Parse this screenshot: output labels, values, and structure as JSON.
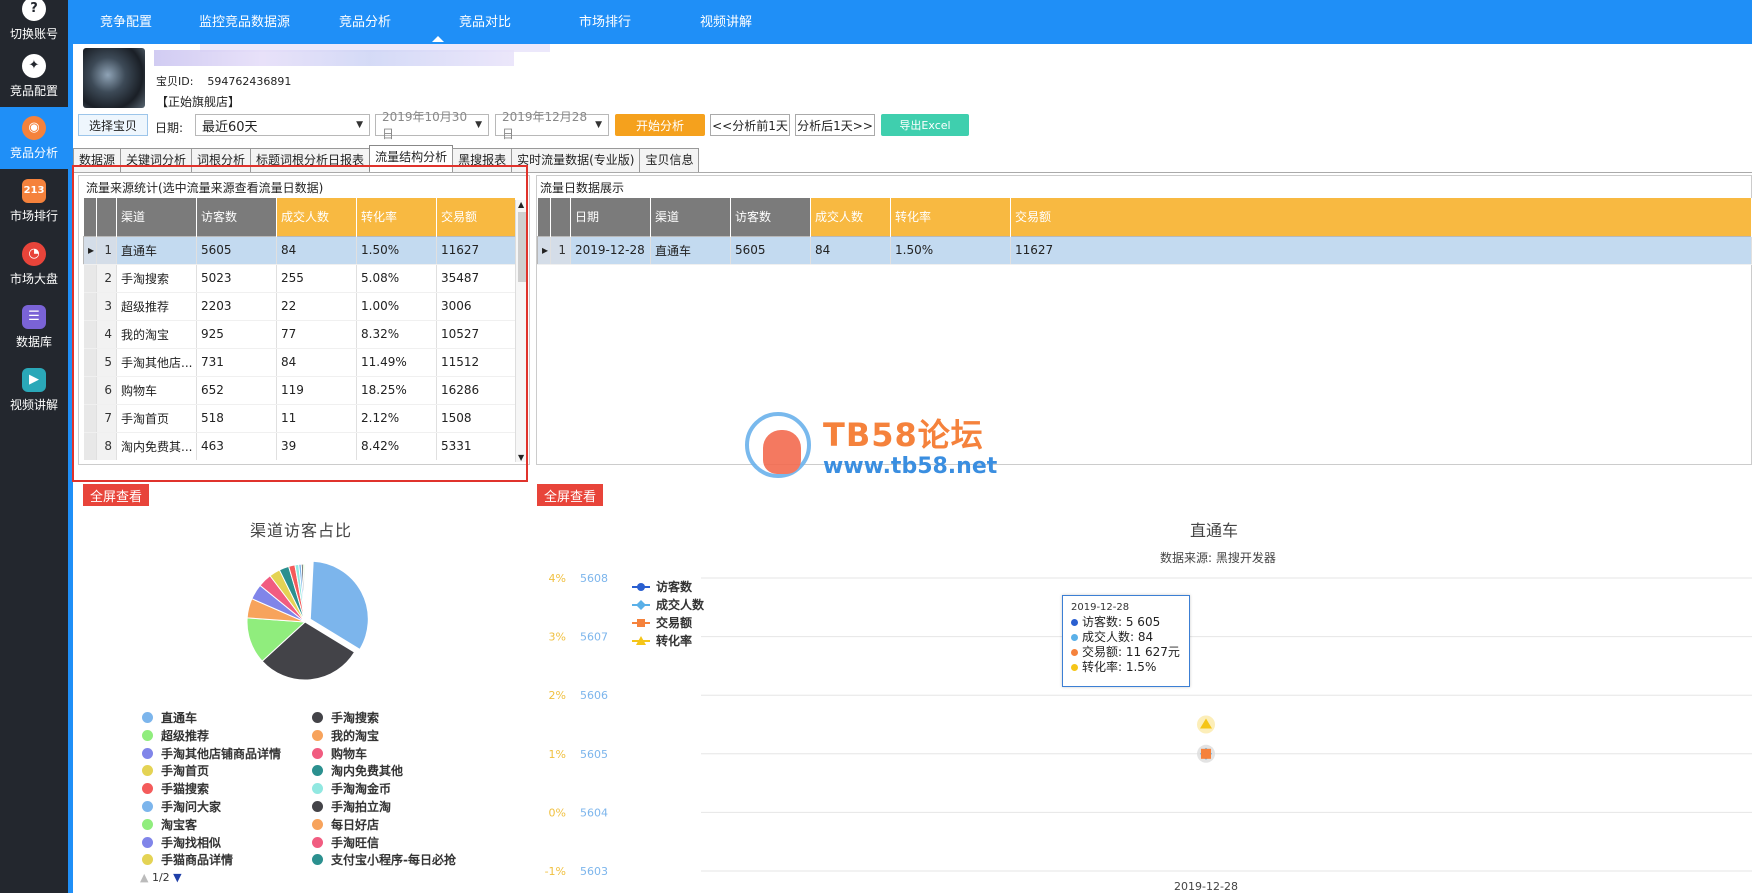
{
  "sidebar": {
    "items": [
      {
        "label": "切换账号",
        "icon": "switch-account-icon",
        "color": "#ffffff"
      },
      {
        "label": "竞品配置",
        "icon": "bird-icon",
        "color": "#ffffff"
      },
      {
        "label": "竞品分析",
        "icon": "eye-icon",
        "color": "#f5823c"
      },
      {
        "label": "市场排行",
        "icon": "ranking-icon",
        "color": "#f5823c"
      },
      {
        "label": "市场大盘",
        "icon": "dashboard-icon",
        "color": "#e8443a"
      },
      {
        "label": "数据库",
        "icon": "database-icon",
        "color": "#7a63d6"
      },
      {
        "label": "视频讲解",
        "icon": "video-icon",
        "color": "#2aa8b8"
      }
    ]
  },
  "topnav": {
    "items": [
      "竞争配置",
      "监控竞品数据源",
      "竞品分析",
      "竞品对比",
      "市场排行",
      "视频讲解"
    ]
  },
  "product": {
    "id_label": "宝贝ID:",
    "id_value": "594762436891",
    "shop": "【正始旗舰店】"
  },
  "toolbar": {
    "choose_label": "选择宝贝",
    "date_label": "日期:",
    "range_value": "最近60天",
    "start_date": "2019年10月30日",
    "end_date": "2019年12月28日",
    "start_label": "开始分析",
    "prev_label": "<<分析前1天",
    "next_label": "分析后1天>>",
    "excel_label": "导出Excel"
  },
  "tabs": [
    "数据源",
    "关键词分析",
    "词根分析",
    "标题词根分析日报表",
    "流量结构分析",
    "黑搜报表",
    "实时流量数据(专业版)",
    "宝贝信息"
  ],
  "left_panel": {
    "title": "流量来源统计(选中流量来源查看流量日数据)",
    "columns": [
      "渠道",
      "访客数",
      "成交人数",
      "转化率",
      "交易额"
    ],
    "rows": [
      {
        "n": "1",
        "channel": "直通车",
        "visitors": "5605",
        "buyers": "84",
        "rate": "1.50%",
        "amount": "11627"
      },
      {
        "n": "2",
        "channel": "手淘搜索",
        "visitors": "5023",
        "buyers": "255",
        "rate": "5.08%",
        "amount": "35487"
      },
      {
        "n": "3",
        "channel": "超级推荐",
        "visitors": "2203",
        "buyers": "22",
        "rate": "1.00%",
        "amount": "3006"
      },
      {
        "n": "4",
        "channel": "我的淘宝",
        "visitors": "925",
        "buyers": "77",
        "rate": "8.32%",
        "amount": "10527"
      },
      {
        "n": "5",
        "channel": "手淘其他店...",
        "visitors": "731",
        "buyers": "84",
        "rate": "11.49%",
        "amount": "11512"
      },
      {
        "n": "6",
        "channel": "购物车",
        "visitors": "652",
        "buyers": "119",
        "rate": "18.25%",
        "amount": "16286"
      },
      {
        "n": "7",
        "channel": "手淘首页",
        "visitors": "518",
        "buyers": "11",
        "rate": "2.12%",
        "amount": "1508"
      },
      {
        "n": "8",
        "channel": "淘内免费其...",
        "visitors": "463",
        "buyers": "39",
        "rate": "8.42%",
        "amount": "5331"
      }
    ]
  },
  "right_panel": {
    "title": "流量日数据展示",
    "columns": [
      "日期",
      "渠道",
      "访客数",
      "成交人数",
      "转化率",
      "交易额"
    ],
    "rows": [
      {
        "n": "1",
        "date": "2019-12-28",
        "channel": "直通车",
        "visitors": "5605",
        "buyers": "84",
        "rate": "1.50%",
        "amount": "11627"
      }
    ]
  },
  "fullscreen_label": "全屏查看",
  "pie": {
    "title": "渠道访客占比",
    "legend": [
      {
        "name": "直通车",
        "color": "#7cb5ec"
      },
      {
        "name": "手淘搜索",
        "color": "#434348"
      },
      {
        "name": "超级推荐",
        "color": "#90ed7d"
      },
      {
        "name": "我的淘宝",
        "color": "#f7a35c"
      },
      {
        "name": "手淘其他店铺商品详情",
        "color": "#8085e9"
      },
      {
        "name": "购物车",
        "color": "#f15c80"
      },
      {
        "name": "手淘首页",
        "color": "#e4d354"
      },
      {
        "name": "淘内免费其他",
        "color": "#2b908f"
      },
      {
        "name": "手猫搜索",
        "color": "#f45b5b"
      },
      {
        "name": "手淘淘金币",
        "color": "#91e8e1"
      },
      {
        "name": "手淘问大家",
        "color": "#7cb5ec"
      },
      {
        "name": "手淘拍立淘",
        "color": "#434348"
      },
      {
        "name": "淘宝客",
        "color": "#90ed7d"
      },
      {
        "name": "每日好店",
        "color": "#f7a35c"
      },
      {
        "name": "手淘找相似",
        "color": "#8085e9"
      },
      {
        "name": "手淘旺信",
        "color": "#f15c80"
      },
      {
        "name": "手猫商品详情",
        "color": "#e4d354"
      },
      {
        "name": "支付宝小程序-每日必抢",
        "color": "#2b908f"
      }
    ],
    "pager": "1/2"
  },
  "chart_data": [
    {
      "type": "pie",
      "title": "渠道访客占比",
      "categories": [
        "直通车",
        "手淘搜索",
        "超级推荐",
        "我的淘宝",
        "手淘其他店铺商品详情",
        "购物车",
        "手淘首页",
        "淘内免费其他",
        "手猫搜索",
        "手淘淘金币",
        "手淘问大家",
        "手淘拍立淘",
        "淘宝客",
        "每日好店",
        "手淘找相似",
        "手淘旺信",
        "手猫商品详情",
        "支付宝小程序-每日必抢"
      ],
      "values": [
        5605,
        5023,
        2203,
        925,
        731,
        652,
        518,
        463,
        300,
        180,
        120,
        90,
        70,
        50,
        40,
        30,
        20,
        10
      ],
      "colors": [
        "#7cb5ec",
        "#434348",
        "#90ed7d",
        "#f7a35c",
        "#8085e9",
        "#f15c80",
        "#e4d354",
        "#2b908f",
        "#f45b5b",
        "#91e8e1",
        "#7cb5ec",
        "#434348",
        "#90ed7d",
        "#f7a35c",
        "#8085e9",
        "#f15c80",
        "#e4d354",
        "#2b908f"
      ]
    },
    {
      "type": "line",
      "title": "直通车",
      "subtitle": "数据来源: 黑搜开发器",
      "x": [
        "2019-12-28"
      ],
      "series": [
        {
          "name": "访客数",
          "values": [
            5605
          ],
          "color": "#2a5fd0"
        },
        {
          "name": "成交人数",
          "values": [
            84
          ],
          "color": "#5ab0e8"
        },
        {
          "name": "交易额",
          "values": [
            11627
          ],
          "color": "#f5823c"
        },
        {
          "name": "转化率",
          "values": [
            1.5
          ],
          "color": "#f5c518"
        }
      ],
      "left_axis_ticks": [
        "4%",
        "3%",
        "2%",
        "1%",
        "0%",
        "-1%"
      ],
      "right_axis_ticks": [
        "5608",
        "5607",
        "5606",
        "5605",
        "5604",
        "5603"
      ],
      "left_axis_color": "#f0c040",
      "right_axis_color": "#7cb5ec",
      "tooltip": {
        "date": "2019-12-28",
        "rows": [
          "访客数: 5 605",
          "成交人数: 84",
          "交易额: 11 627元",
          "转化率: 1.5%"
        ]
      }
    }
  ],
  "watermark": {
    "title": "TB58论坛",
    "url": "www.tb58.net"
  }
}
